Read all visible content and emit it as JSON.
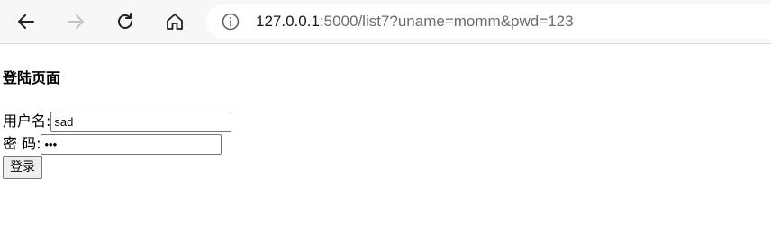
{
  "browser": {
    "url_host": "127.0.0.1",
    "url_rest": ":5000/list7?uname=momm&pwd=123",
    "icons": {
      "back": "back-arrow-icon",
      "forward": "forward-arrow-icon",
      "refresh": "refresh-icon",
      "home": "home-icon",
      "site_info": "info-icon"
    }
  },
  "page": {
    "heading": "登陆页面",
    "username_label": "用户名:",
    "username_value": "sad",
    "password_label": "密 码:",
    "password_value": "123",
    "login_button": "登录"
  }
}
